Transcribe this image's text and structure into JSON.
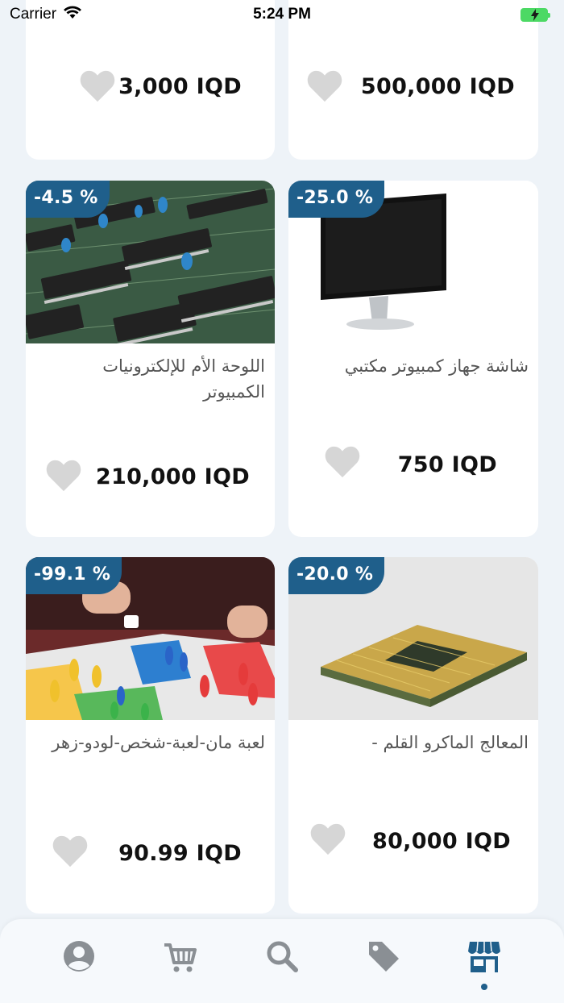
{
  "status_bar": {
    "carrier": "Carrier",
    "time": "5:24 PM"
  },
  "products": [
    {
      "id": "top-left",
      "price": "3,000 IQD",
      "favorited": false
    },
    {
      "id": "top-right",
      "price": "500,000 IQD",
      "favorited": false
    },
    {
      "id": "motherboard",
      "badge": "-4.5 %",
      "title": "اللوحة الأم للإلكترونيات الكمبيوتر",
      "price": "210,000 IQD",
      "image": "circuit-board",
      "favorited": false
    },
    {
      "id": "monitor",
      "badge": "-25.0 %",
      "title": "شاشة جهاز كمبيوتر مكتبي",
      "price": "750 IQD",
      "image": "computer-monitor",
      "favorited": false
    },
    {
      "id": "ludo",
      "badge": "-99.1 %",
      "title": "لعبة مان-لعبة-شخص-لودو-زهر",
      "price": "90.99 IQD",
      "image": "ludo-board-game",
      "favorited": false
    },
    {
      "id": "cpu",
      "badge": "-20.0 %",
      "title": "المعالج الماكرو القلم -",
      "price": "80,000 IQD",
      "image": "cpu-chip",
      "favorited": false
    }
  ],
  "bottom_nav": {
    "items": [
      "profile-icon",
      "cart-icon",
      "search-icon",
      "tag-icon",
      "store-icon"
    ],
    "active": "store-icon"
  },
  "colors": {
    "accent": "#1f5f8b",
    "background": "#eef3f8",
    "heart": "#d6d6d6",
    "nav_icon": "#8a8f94"
  }
}
